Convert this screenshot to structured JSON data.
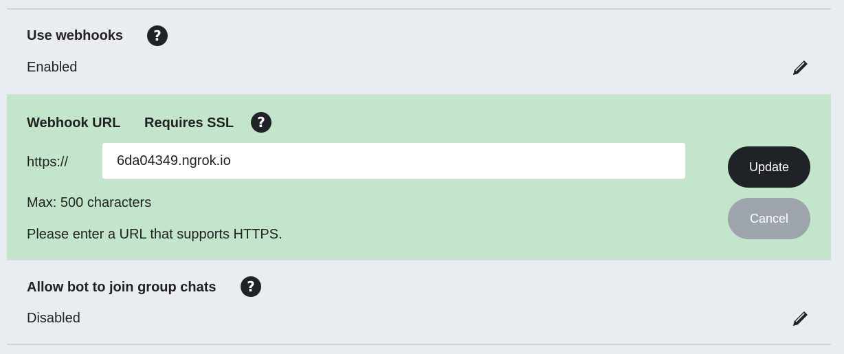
{
  "webhooks_section": {
    "title": "Use webhooks",
    "value": "Enabled",
    "help_glyph": "?",
    "help_icon": "question-circle-icon",
    "edit_icon": "pencil-icon"
  },
  "webhook_url_section": {
    "title": "Webhook URL",
    "subtitle": "Requires SSL",
    "help_glyph": "?",
    "help_icon": "question-circle-icon",
    "prefix": "https://",
    "url_value": "6da04349.ngrok.io",
    "max_hint": "Max: 500 characters",
    "https_hint": "Please enter a URL that supports HTTPS.",
    "update_label": "Update",
    "cancel_label": "Cancel"
  },
  "group_chat_section": {
    "title": "Allow bot to join group chats",
    "value": "Disabled",
    "help_glyph": "?",
    "help_icon": "question-circle-icon",
    "edit_icon": "pencil-icon"
  },
  "colors": {
    "page_bg": "#e9edf1",
    "edit_panel_bg": "#c3e5cb",
    "primary_button": "#1f2328",
    "secondary_button": "#9ea4ab"
  }
}
